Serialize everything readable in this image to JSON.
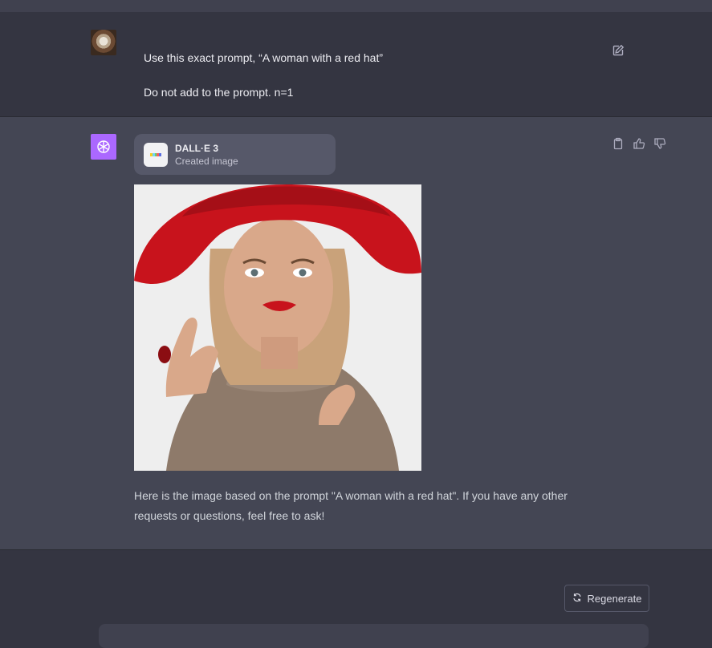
{
  "conversation": {
    "user_message": {
      "line1": "Use this exact prompt, “A woman with a red hat”",
      "line2": "Do not add to the prompt. n=1"
    },
    "assistant_message": {
      "tool_card": {
        "title": "DALL·E 3",
        "subtitle": "Created image"
      },
      "image": {
        "colors": {
          "hat": "#c8131c",
          "skin": "#d9a88a",
          "hair": "#c9a27a",
          "sweater": "#8e7a6a",
          "background": "#eeeeee"
        }
      },
      "text": "Here is the image based on the prompt \"A woman with a red hat\". If you have any other requests or questions, feel free to ask!"
    }
  },
  "actions": {
    "regenerate_label": "Regenerate"
  },
  "icons": {
    "edit": "edit-icon",
    "copy": "clipboard-icon",
    "like": "thumbs-up-icon",
    "dislike": "thumbs-down-icon",
    "regenerate": "refresh-icon",
    "assistant_avatar": "openai-logo-icon"
  },
  "theme": {
    "accent": "#ab68ff",
    "background": "#343541",
    "assistant_bg": "#444654"
  }
}
